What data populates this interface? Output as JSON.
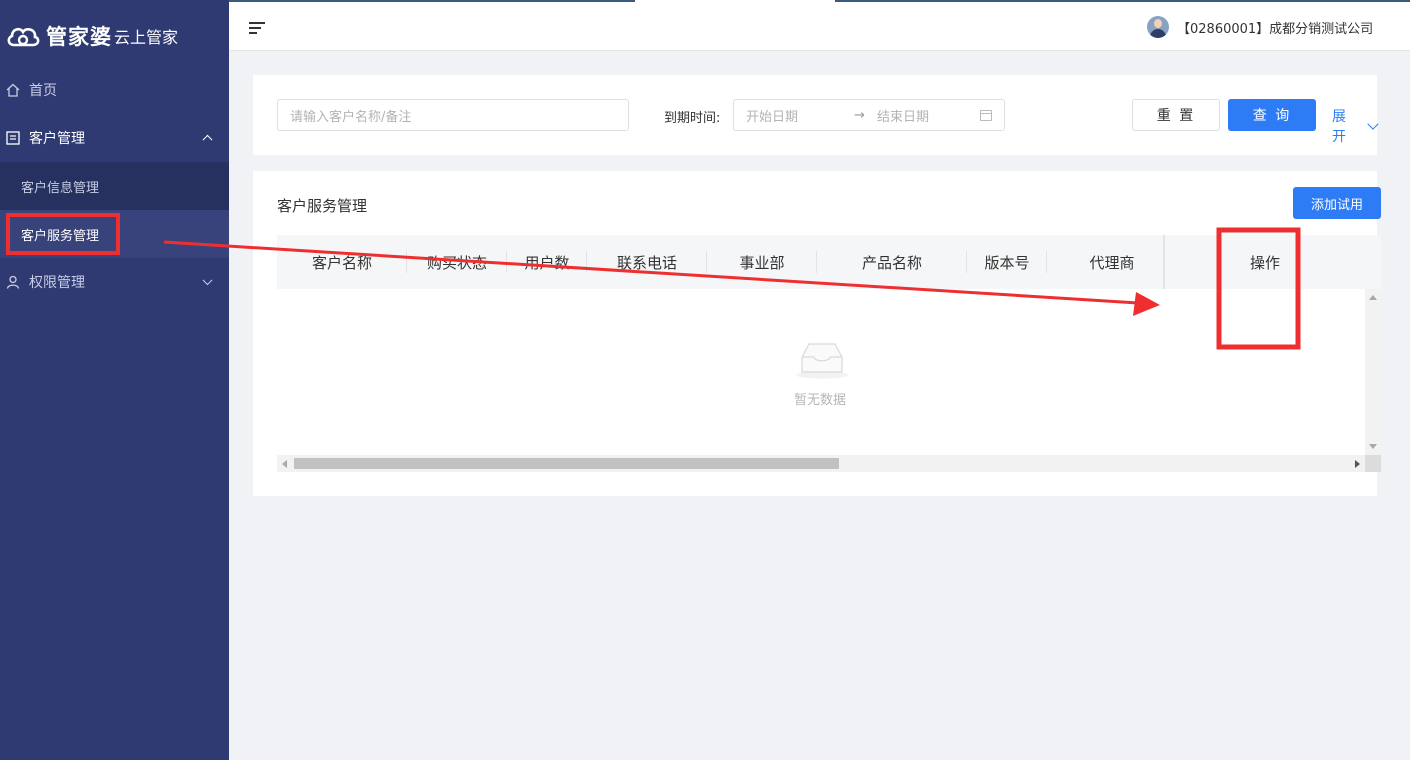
{
  "app": {
    "logo_main": "管家婆",
    "logo_sub": "云上管家"
  },
  "sidebar": {
    "items": [
      {
        "label": "首页",
        "icon": "home-icon"
      },
      {
        "label": "客户管理",
        "icon": "list-icon",
        "expanded": true,
        "children": [
          {
            "label": "客户信息管理",
            "active": false
          },
          {
            "label": "客户服务管理",
            "active": true
          }
        ]
      },
      {
        "label": "权限管理",
        "icon": "user-icon",
        "expanded": false
      }
    ]
  },
  "header": {
    "company": "【02860001】成都分销测试公司"
  },
  "search": {
    "keyword_placeholder": "请输入客户名称/备注",
    "date_label": "到期时间:",
    "start_placeholder": "开始日期",
    "range_sep": "→",
    "end_placeholder": "结束日期",
    "reset_label": "重 置",
    "query_label": "查 询",
    "expand_label": "展开"
  },
  "table": {
    "title": "客户服务管理",
    "add_label": "添加试用",
    "columns": [
      "客户名称",
      "购买状态",
      "用户数",
      "联系电话",
      "事业部",
      "产品名称",
      "版本号",
      "代理商",
      "操作"
    ],
    "empty_text": "暂无数据"
  },
  "colors": {
    "sidebar_bg": "#2f3a72",
    "primary": "#2d7cf6",
    "annotation": "#ef2f2f"
  }
}
